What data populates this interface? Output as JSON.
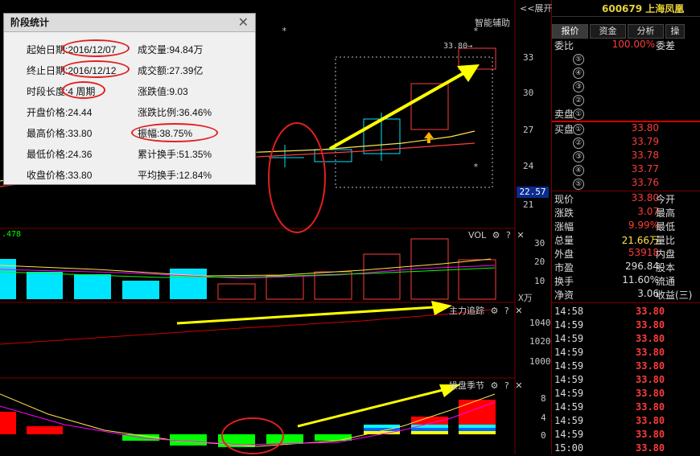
{
  "stock": {
    "code_name": "600679 上海凤凰",
    "expand_label": "<<展开"
  },
  "tabs": [
    "报价",
    "资金",
    "分析",
    "操"
  ],
  "main_panel": {
    "label": "智能辅助",
    "price_marker": "33.80→",
    "axis": [
      "33",
      "30",
      "27",
      "24",
      "21"
    ],
    "current_price_tag": "22.57",
    "star": "*"
  },
  "vol_panel": {
    "label": "VOL",
    "value_left": ".478",
    "axis": [
      "30",
      "20",
      "10"
    ],
    "unit": "X万"
  },
  "power_panel": {
    "label": "主力追踪",
    "axis": [
      "1040",
      "1020",
      "1000"
    ]
  },
  "season_panel": {
    "label": "操盘季节",
    "axis": [
      "8",
      "4",
      "0"
    ]
  },
  "dialog": {
    "title": "阶段统计",
    "left": [
      {
        "k": "起始日期:",
        "v": "2016/12/07"
      },
      {
        "k": "终止日期:",
        "v": "2016/12/12"
      },
      {
        "k": "时段长度:",
        "v": "4 周期"
      },
      {
        "k": "开盘价格:",
        "v": "24.44"
      },
      {
        "k": "最高价格:",
        "v": "33.80"
      },
      {
        "k": "最低价格:",
        "v": "24.36"
      },
      {
        "k": "收盘价格:",
        "v": "33.80"
      }
    ],
    "right": [
      {
        "k": "成交量:",
        "v": "94.84万"
      },
      {
        "k": "成交额:",
        "v": "27.39亿"
      },
      {
        "k": "涨跌值:",
        "v": "9.03"
      },
      {
        "k": "涨跌比例:",
        "v": "36.46%"
      },
      {
        "k": "振幅:",
        "v": "38.75%"
      },
      {
        "k": "累计换手:",
        "v": "51.35%"
      },
      {
        "k": "平均换手:",
        "v": "12.84%"
      }
    ]
  },
  "quote": {
    "weibi_label": "委比",
    "weibi_value": "100.00%",
    "weicha_label": "委差",
    "sell_label": "卖盘",
    "sell_levels": [
      "⑤",
      "④",
      "③",
      "②",
      "①"
    ],
    "buy_label": "买盘",
    "buy_levels": [
      {
        "n": "①",
        "p": "33.80"
      },
      {
        "n": "②",
        "p": "33.79"
      },
      {
        "n": "③",
        "p": "33.78"
      },
      {
        "n": "④",
        "p": "33.77"
      },
      {
        "n": "⑤",
        "p": "33.76"
      }
    ],
    "stats": [
      {
        "l": "现价",
        "v": "33.80",
        "r": "今开",
        "vc": "red"
      },
      {
        "l": "涨跌",
        "v": "3.07",
        "r": "最高",
        "vc": "red"
      },
      {
        "l": "涨幅",
        "v": "9.99%",
        "r": "最低",
        "vc": "red"
      },
      {
        "l": "总量",
        "v": "21.66万",
        "r": "量比",
        "vc": "yel"
      },
      {
        "l": "外盘",
        "v": "53918",
        "r": "内盘",
        "vc": "red"
      },
      {
        "l": "市盈",
        "v": "296.84",
        "r": "股本",
        "vc": "white"
      },
      {
        "l": "换手",
        "v": "11.60%",
        "r": "流通",
        "vc": "white"
      },
      {
        "l": "净资",
        "v": "3.06",
        "r": "收益(三)",
        "vc": "white"
      }
    ]
  },
  "ticks": [
    {
      "t": "14:58",
      "p": "33.80"
    },
    {
      "t": "14:59",
      "p": "33.80"
    },
    {
      "t": "14:59",
      "p": "33.80"
    },
    {
      "t": "14:59",
      "p": "33.80"
    },
    {
      "t": "14:59",
      "p": "33.80"
    },
    {
      "t": "14:59",
      "p": "33.80"
    },
    {
      "t": "14:59",
      "p": "33.80"
    },
    {
      "t": "14:59",
      "p": "33.80"
    },
    {
      "t": "14:59",
      "p": "33.80"
    },
    {
      "t": "14:59",
      "p": "33.80"
    },
    {
      "t": "15:00",
      "p": "33.80"
    }
  ],
  "colors": {
    "up": "#ff3b3b",
    "down": "#00e5ff",
    "green": "#00ff00",
    "arrow": "#ffff00",
    "ellipse": "#e02020"
  }
}
